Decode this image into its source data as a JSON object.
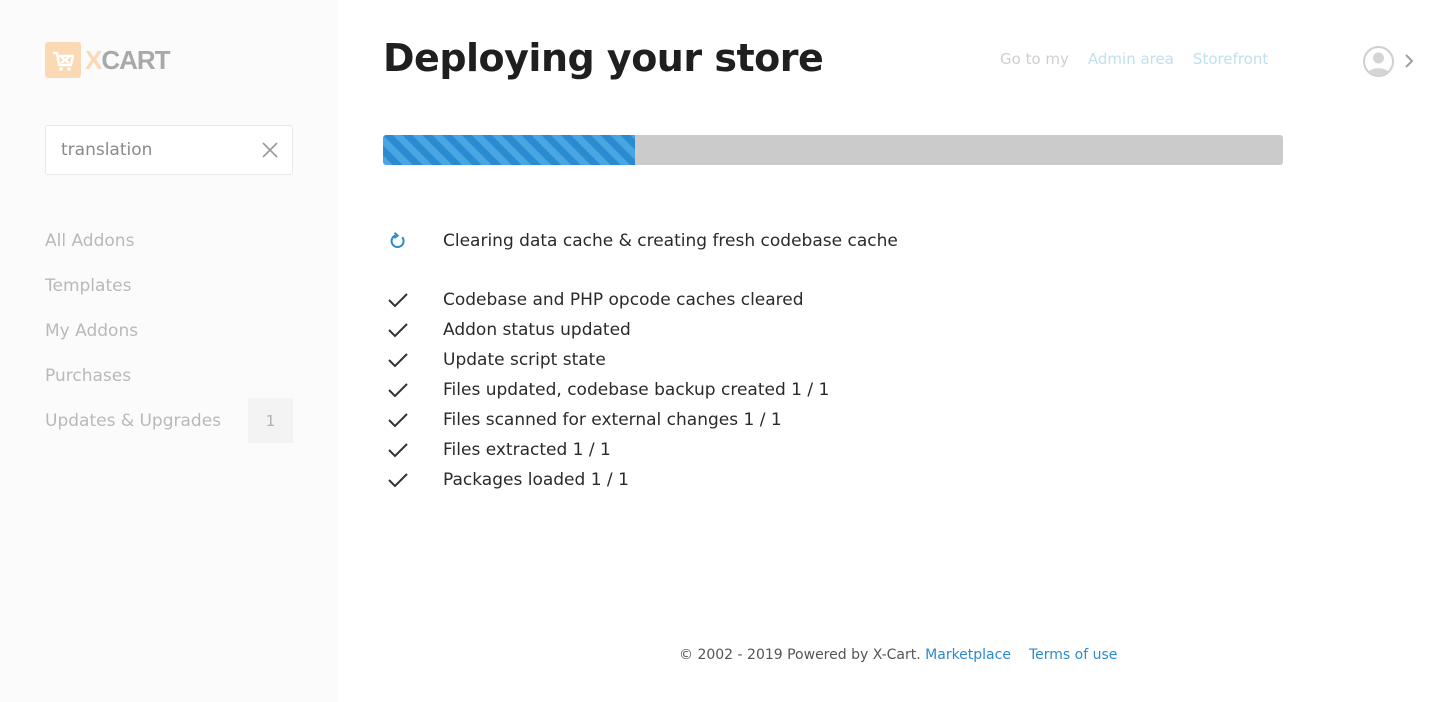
{
  "brand": {
    "logo_x": "X",
    "logo_cart": "CART",
    "accent_color": "#fbd9b5"
  },
  "search": {
    "value": "translation",
    "clear_icon": "close-icon"
  },
  "sidebar": {
    "items": [
      {
        "label": "All Addons"
      },
      {
        "label": "Templates"
      },
      {
        "label": "My Addons"
      },
      {
        "label": "Purchases"
      },
      {
        "label": "Updates & Upgrades",
        "badge": "1"
      }
    ]
  },
  "header": {
    "title": "Deploying your store",
    "goto_label": "Go to my",
    "admin_link": "Admin area",
    "storefront_link": "Storefront",
    "avatar_icon": "user-avatar-icon"
  },
  "progress": {
    "fraction": 0.28,
    "color": "#2a8bd0"
  },
  "steps": {
    "current": {
      "icon": "refresh-icon",
      "text": "Clearing data cache & creating fresh codebase cache"
    },
    "completed": [
      {
        "icon": "check-icon",
        "text": "Codebase and PHP opcode caches cleared"
      },
      {
        "icon": "check-icon",
        "text": "Addon status updated"
      },
      {
        "icon": "check-icon",
        "text": "Update script state"
      },
      {
        "icon": "check-icon",
        "text": "Files updated, codebase backup created 1 / 1"
      },
      {
        "icon": "check-icon",
        "text": "Files scanned for external changes 1 / 1"
      },
      {
        "icon": "check-icon",
        "text": "Files extracted 1 / 1"
      },
      {
        "icon": "check-icon",
        "text": "Packages loaded 1 / 1"
      }
    ]
  },
  "footer": {
    "copyright": "© 2002 - 2019 Powered by X-Cart.",
    "marketplace_link": "Marketplace",
    "terms_link": "Terms of use"
  }
}
